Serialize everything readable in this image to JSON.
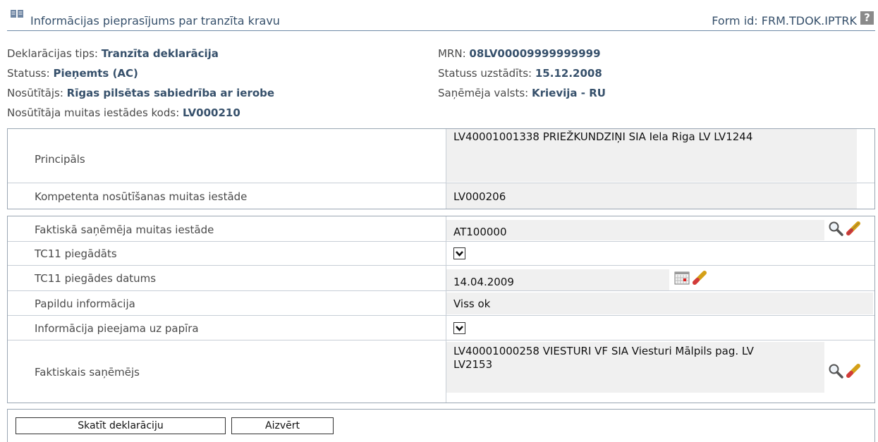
{
  "header": {
    "title": "Informācijas pieprasījums par tranzīta kravu",
    "form_id": "Form id: FRM.TDOK.IPTRK",
    "help": "?"
  },
  "info": {
    "decl_type_label": "Deklarācijas tips:",
    "decl_type_value": "Tranzīta deklarācija",
    "status_label": "Statuss:",
    "status_value": "Pieņemts (AC)",
    "sender_label": "Nosūtītājs:",
    "sender_value": "Rīgas pilsētas sabiedrība ar ierobe",
    "sender_code_label": "Nosūtītāja muitas iestādes kods:",
    "sender_code_value": "LV000210",
    "mrn_label": "MRN:",
    "mrn_value": "08LV00009999999999",
    "status_set_label": "Statuss uzstādīts:",
    "status_set_value": "15.12.2008",
    "receiver_country_label": "Saņēmēja valsts:",
    "receiver_country_value": "Krievija - RU"
  },
  "panel1": {
    "principal_label": "Principāls",
    "principal_value": "LV40001001338 PRIEŽKUNDZIŅI SIA Iela Riga LV LV1244",
    "office_label": "Kompetenta nosūtīšanas muitas iestāde",
    "office_value": "LV000206"
  },
  "panel2": {
    "actual_office_label": "Faktiskā saņēmēja muitas iestāde",
    "actual_office_value": "AT100000",
    "tc11_delivered_label": "TC11 piegādāts",
    "tc11_delivered_checked": true,
    "tc11_date_label": "TC11 piegādes datums",
    "tc11_date_value": "14.04.2009",
    "extra_info_label": "Papildu informācija",
    "extra_info_value": "Viss ok",
    "paper_info_label": "Informācija pieejama uz papīra",
    "paper_info_checked": true,
    "actual_receiver_label": "Faktiskais saņēmējs",
    "actual_receiver_line1": "LV40001000258 VIESTURI VF SIA Viesturi Mālpils pag. LV",
    "actual_receiver_line2": "LV2153"
  },
  "buttons": {
    "view_declaration": "Skatīt deklarāciju",
    "close": "Aizvērt"
  },
  "icons": {
    "title": "book-icon",
    "search": "magnifier-icon",
    "clear": "eraser-icon",
    "calendar": "calendar-icon"
  },
  "colors": {
    "accent_text": "#36506b",
    "field_bg": "#f0f0f0",
    "border": "#9aa6b3"
  }
}
